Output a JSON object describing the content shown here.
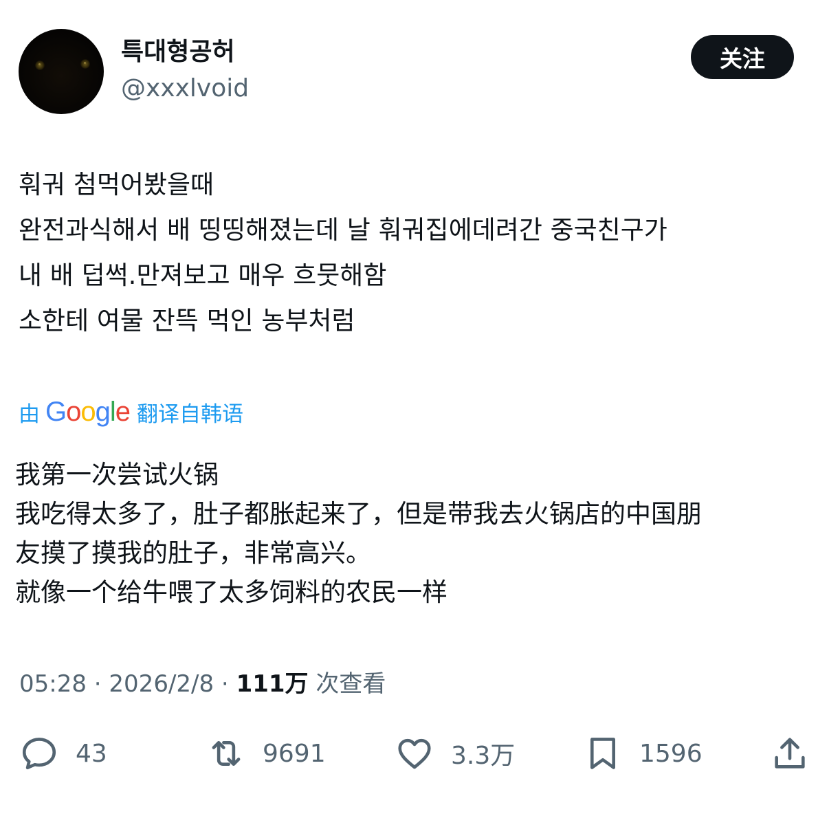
{
  "author": {
    "name": "특대형공허",
    "handle": "@xxxlvoid"
  },
  "follow_button": {
    "label": "关注"
  },
  "tweet": {
    "lines": [
      "훠궈 첨먹어봤을때",
      "완전과식해서 배 띵띵해졌는데 날 훠궈집에데려간 중국친구가",
      "내 배 덥썩.만져보고 매우 흐뭇해함",
      "소한테 여물 잔뜩 먹인 농부처럼"
    ]
  },
  "translation": {
    "by_label": "由",
    "provider_logo_text": [
      "G",
      "o",
      "o",
      "g",
      "l",
      "e"
    ],
    "logo_colors": [
      "#4285F4",
      "#EA4335",
      "#FBBC05",
      "#4285F4",
      "#34A853",
      "#EA4335"
    ],
    "translated_from_label": "翻译自韩语",
    "lines": [
      "我第一次尝试火锅",
      "我吃得太多了，肚子都胀起来了，但是带我去火锅店的中国朋",
      "友摸了摸我的肚子，非常高兴。",
      "就像一个给牛喂了太多饲料的农民一样"
    ]
  },
  "meta": {
    "time": "05:28",
    "separator": " · ",
    "date": "2026/2/8",
    "views_count": "111万",
    "views_label": " 次查看"
  },
  "actions": {
    "reply": {
      "icon": "reply-icon",
      "count": "43"
    },
    "retweet": {
      "icon": "retweet-icon",
      "count": "9691"
    },
    "like": {
      "icon": "heart-icon",
      "count": "3.3万"
    },
    "bookmark": {
      "icon": "bookmark-icon",
      "count": "1596"
    },
    "share": {
      "icon": "share-icon"
    }
  },
  "colors": {
    "text_primary": "#0f1419",
    "text_secondary": "#536471",
    "link_blue": "#1d9bf0",
    "button_bg": "#0f1419",
    "background": "#ffffff"
  }
}
